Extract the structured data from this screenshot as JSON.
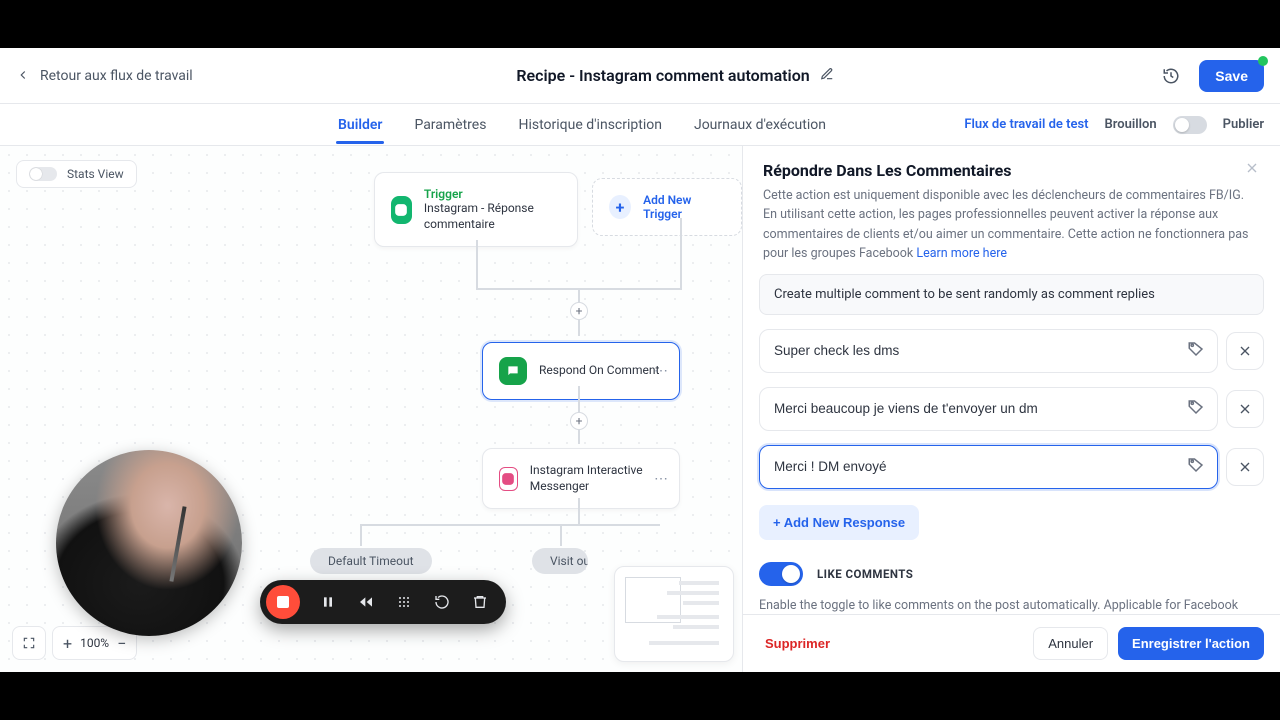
{
  "topbar": {
    "back_label": "Retour aux flux de travail",
    "page_title": "Recipe - Instagram comment automation",
    "save_label": "Save"
  },
  "subnav": {
    "tabs": {
      "builder": "Builder",
      "parametres": "Paramètres",
      "history": "Historique d'inscription",
      "logs": "Journaux d'exécution"
    },
    "test_link": "Flux de travail de test",
    "draft_label": "Brouillon",
    "publish_label": "Publier"
  },
  "canvas": {
    "stats_view_label": "Stats View",
    "trigger": {
      "kicker": "Trigger",
      "title": "Instagram - Réponse commentaire"
    },
    "add_trigger_label": "Add New Trigger",
    "respond_node": "Respond On Comment",
    "ig_node": "Instagram Interactive Messenger",
    "pill_default": "Default Timeout",
    "pill_visit": "Visit ou…",
    "zoom": "100%"
  },
  "panel": {
    "title": "Répondre Dans Les Commentaires",
    "desc": "Cette action est uniquement disponible avec les déclencheurs de commentaires FB/IG. En utilisant cette action, les pages professionnelles peuvent activer la réponse aux commentaires de clients et/ou aimer un commentaire. Cette action ne fonctionnera pas pour les groupes Facebook ",
    "learn_more": "Learn more here",
    "hint": "Create multiple comment to be sent randomly as comment replies",
    "responses": [
      "Super check les dms",
      "Merci beaucoup je viens de t'envoyer un dm",
      "Merci ! DM envoyé"
    ],
    "add_response": "+ Add New Response",
    "like_label": "LIKE COMMENTS",
    "note": "Enable the toggle to like comments on the post automatically. Applicable for Facebook posts only, Instagram is not supported.",
    "footer": {
      "delete": "Supprimer",
      "cancel": "Annuler",
      "save": "Enregistrer l'action"
    }
  }
}
